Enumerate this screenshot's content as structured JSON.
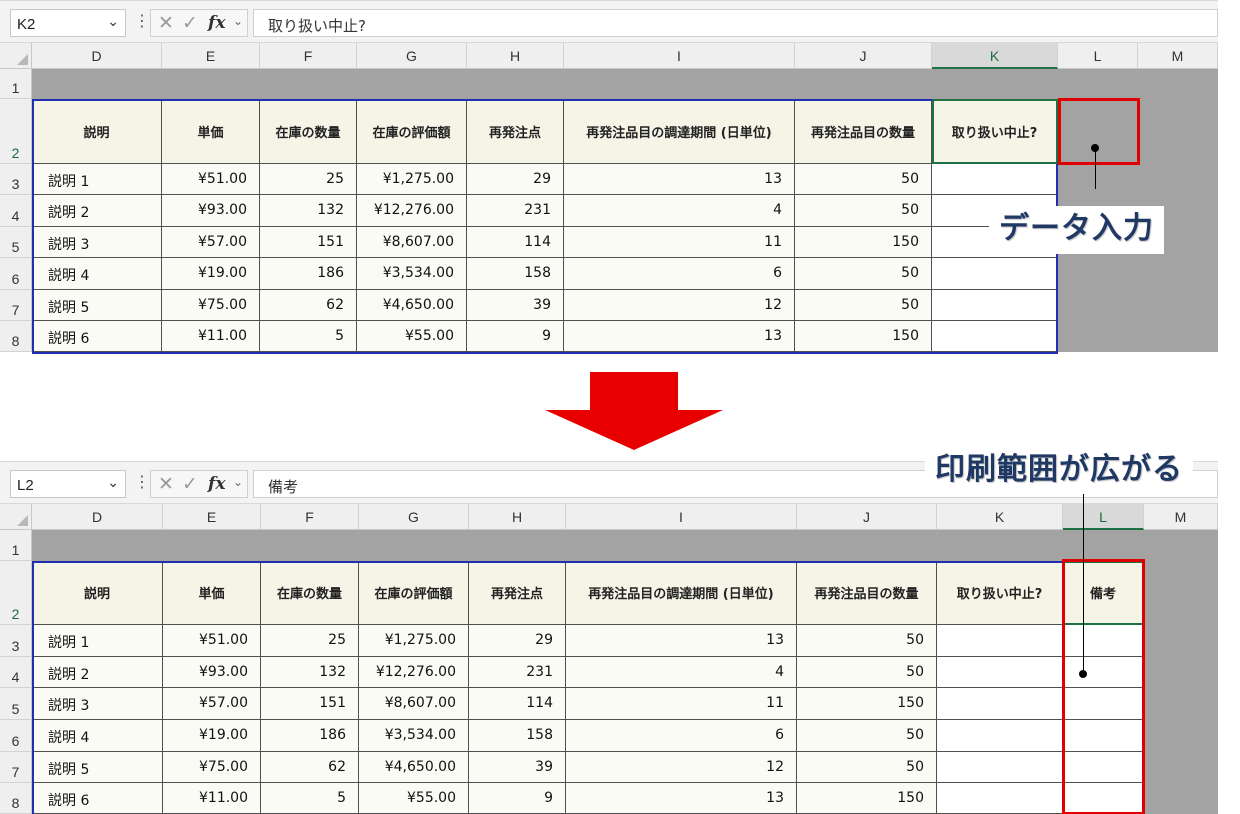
{
  "columns": [
    "D",
    "E",
    "F",
    "G",
    "H",
    "I",
    "J",
    "K",
    "L",
    "M"
  ],
  "rows": [
    "1",
    "2",
    "3",
    "4",
    "5",
    "6",
    "7",
    "8"
  ],
  "table_headers": [
    "説明",
    "単価",
    "在庫の数量",
    "在庫の評価額",
    "再発注点",
    "再発注品目の調達期間 (日単位)",
    "再発注品目の数量",
    "取り扱い中止?"
  ],
  "table_rows": [
    [
      "説明 1",
      "¥51.00",
      "25",
      "¥1,275.00",
      "29",
      "13",
      "50"
    ],
    [
      "説明 2",
      "¥93.00",
      "132",
      "¥12,276.00",
      "231",
      "4",
      "50"
    ],
    [
      "説明 3",
      "¥57.00",
      "151",
      "¥8,607.00",
      "114",
      "11",
      "150"
    ],
    [
      "説明 4",
      "¥19.00",
      "186",
      "¥3,534.00",
      "158",
      "6",
      "50"
    ],
    [
      "説明 5",
      "¥75.00",
      "62",
      "¥4,650.00",
      "39",
      "12",
      "50"
    ],
    [
      "説明 6",
      "¥11.00",
      "5",
      "¥55.00",
      "9",
      "13",
      "150"
    ]
  ],
  "top": {
    "name_box": "K2",
    "formula": "取り扱い中止?",
    "callout": "データ入力"
  },
  "bottom": {
    "name_box": "L2",
    "formula": "備考",
    "new_header": "備考",
    "callout": "印刷範囲が広がる"
  },
  "colors": {
    "accent_red": "#e00000",
    "print_area_blue": "#1f2fb0",
    "callout_text": "#1f3864"
  }
}
